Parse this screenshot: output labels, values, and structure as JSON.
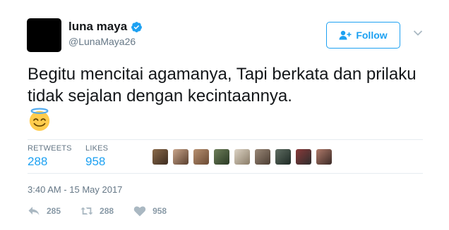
{
  "user": {
    "display_name": "luna maya",
    "handle": "@LunaMaya26",
    "verified_icon": "verified-badge-icon"
  },
  "follow_button": {
    "label": "Follow",
    "icon": "add-user-icon"
  },
  "menu": {
    "icon": "chevron-down-icon"
  },
  "tweet": {
    "text": "Begitu mencitai agamanya, Tapi berkata dan prilaku tidak sejalan dengan kecintaannya.",
    "emoji": "smiling-face-with-halo"
  },
  "stats": {
    "retweets_label": "RETWEETS",
    "retweets_value": "288",
    "likes_label": "LIKES",
    "likes_value": "958"
  },
  "likers": {
    "count_shown": 9
  },
  "timestamp": "3:40 AM - 15 May 2017",
  "actions": {
    "reply_count": "285",
    "retweet_count": "288",
    "like_count": "958"
  },
  "colors": {
    "accent": "#1da1f2",
    "muted": "#657786",
    "action_gray": "#aab8c2",
    "divider": "#e6ecf0"
  }
}
